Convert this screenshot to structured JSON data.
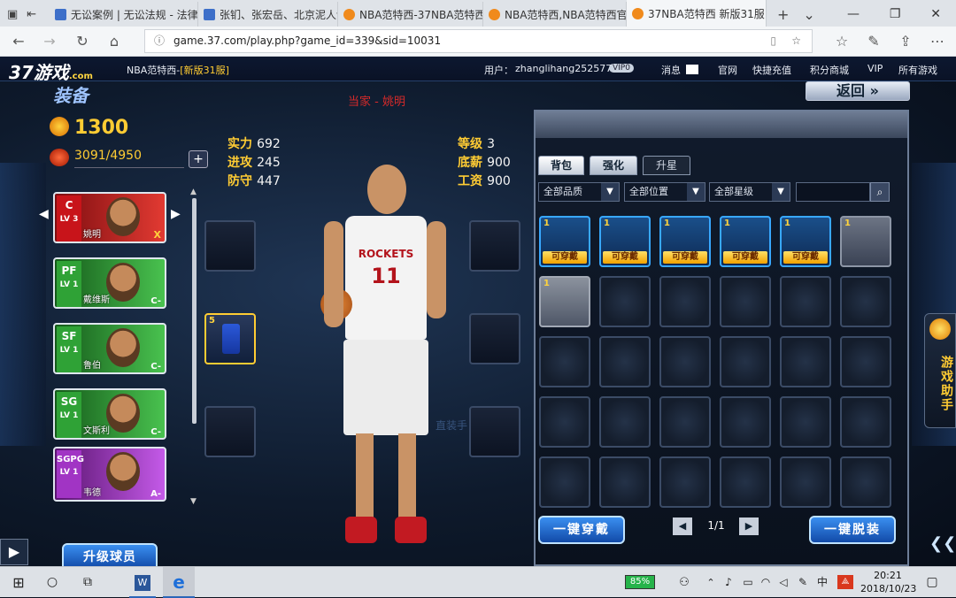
{
  "browser": {
    "tabs": [
      {
        "label": "无讼案例 | 无讼法规 - 法律",
        "favicon": "blue"
      },
      {
        "label": "张钔、张宏岳、北京泥人剑",
        "favicon": "blue"
      },
      {
        "label": "NBA范特西-37NBA范特西",
        "favicon": "orange"
      },
      {
        "label": "NBA范特西,NBA范特西官网",
        "favicon": "orange"
      },
      {
        "label": "37NBA范特西 新版31服",
        "favicon": "orange",
        "active": true
      }
    ],
    "url": "game.37.com/play.php?game_id=339&sid=10031"
  },
  "game": {
    "logo": "37游戏",
    "logo_sub": ".com",
    "server_title": "NBA范特西-",
    "server_name": "[新版31服]",
    "user_label": "用户：",
    "username": "zhanglihang252577",
    "vip_badge": "VIP0",
    "top_links": [
      "消息",
      "官网",
      "快捷充值",
      "积分商城",
      "VIP",
      "所有游戏"
    ],
    "page_title": "装备",
    "back_label": "返回",
    "captain_label": "当家 - 姚明",
    "coins": "1300",
    "stamina": "3091/4950",
    "stats_left": [
      {
        "label": "实力",
        "value": "692"
      },
      {
        "label": "进攻",
        "value": "245"
      },
      {
        "label": "防守",
        "value": "447"
      }
    ],
    "stats_right": [
      {
        "label": "等级",
        "value": "3"
      },
      {
        "label": "底薪",
        "value": "900"
      },
      {
        "label": "工资",
        "value": "900"
      }
    ],
    "roster": [
      {
        "pos": "C",
        "lv": "LV 3",
        "name": "姚明",
        "grade": "X",
        "color": "#c8141a"
      },
      {
        "pos": "PF",
        "lv": "LV 1",
        "name": "戴维斯",
        "grade": "C-",
        "color": "#2fa236"
      },
      {
        "pos": "SF",
        "lv": "LV 1",
        "name": "鲁伯",
        "grade": "C-",
        "color": "#2fa236"
      },
      {
        "pos": "SG",
        "lv": "LV 1",
        "name": "文斯利",
        "grade": "C-",
        "color": "#2fa236"
      },
      {
        "pos": "SGPG",
        "lv": "LV 1",
        "name": "韦德",
        "grade": "A-",
        "color": "#a134c4"
      }
    ],
    "jersey_number": "11",
    "jersey_team": "ROCKETS",
    "equip_count": "5",
    "upgrade_button": "升级球员",
    "panel_tabs": [
      "背包",
      "强化",
      "升星"
    ],
    "filters": [
      "全部品质",
      "全部位置",
      "全部星级"
    ],
    "search_placeholder": "",
    "items": [
      {
        "count": "1",
        "tag": "可穿戴"
      },
      {
        "count": "1",
        "tag": "可穿戴"
      },
      {
        "count": "1",
        "tag": "可穿戴"
      },
      {
        "count": "1",
        "tag": "可穿戴"
      },
      {
        "count": "1",
        "tag": "可穿戴"
      },
      {
        "count": "1",
        "tag": ""
      },
      {
        "count": "1",
        "tag": ""
      }
    ],
    "equip_all_button": "一键穿戴",
    "unequip_all_button": "一键脱装",
    "page_indicator": "1/1",
    "side_helper": "游戏助手",
    "watermark": "直装手"
  },
  "taskbar": {
    "battery": "85%",
    "ime": "中",
    "time": "20:21",
    "date": "2018/10/23"
  }
}
